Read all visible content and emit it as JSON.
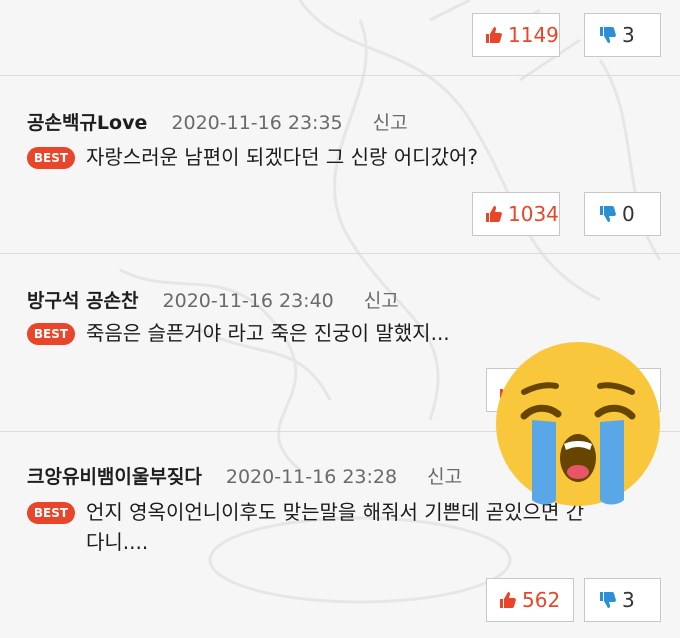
{
  "comments": [
    {
      "user": "",
      "date": "",
      "report": "",
      "best": "",
      "text": "",
      "likes": "1149",
      "dislikes": "3"
    },
    {
      "user": "공손백규Love",
      "date": "2020-11-16 23:35",
      "report": "신고",
      "best": "BEST",
      "text": "자랑스러운 남편이 되겠다던 그 신랑 어디갔어?",
      "likes": "1034",
      "dislikes": "0"
    },
    {
      "user": "방구석 공손찬",
      "date": "2020-11-16 23:40",
      "report": "신고",
      "best": "BEST",
      "text": "죽음은 슬픈거야 라고 죽은 진궁이 말했지...",
      "likes": "",
      "dislikes": ""
    },
    {
      "user": "크앙유비뱀이울부짖다",
      "date": "2020-11-16 23:28",
      "report": "신고",
      "best": "BEST",
      "text": "언지 영옥이언니이후도 맞는말을 해줘서 기쁜데 곧있으면 간다니....",
      "likes": "562",
      "dislikes": "3"
    }
  ],
  "overlay_emoji": "loudly-crying-face",
  "colors": {
    "accent": "#e8462a",
    "dislike_icon": "#2a8fd6",
    "emoji_face": "#f9c73c",
    "emoji_tears": "#5aa7e8"
  }
}
